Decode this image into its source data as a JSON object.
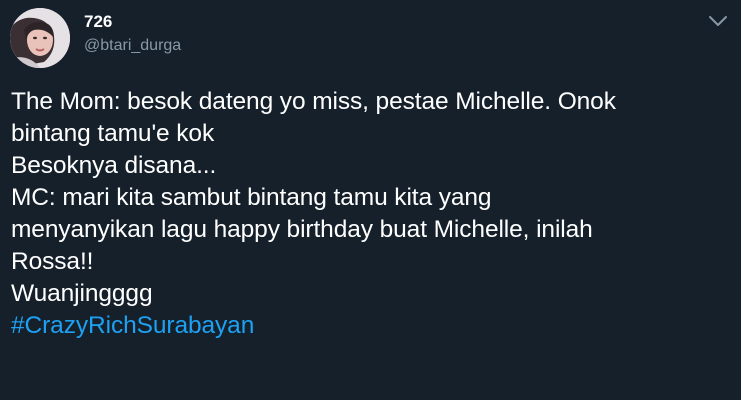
{
  "author": {
    "display_name": "726",
    "handle": "@btari_durga",
    "avatar_icon": "profile-photo"
  },
  "menu": {
    "icon": "chevron-down-icon"
  },
  "tweet": {
    "lines": [
      "The Mom: besok dateng yo miss, pestae Michelle. Onok",
      "bintang tamu'e kok",
      "Besoknya disana...",
      "MC: mari kita sambut bintang tamu kita yang",
      "menyanyikan lagu happy birthday buat Michelle, inilah",
      "Rossa!!",
      "Wuanjingggg"
    ],
    "hashtag": "#CrazyRichSurabayan"
  },
  "colors": {
    "background": "#15202b",
    "text": "#ffffff",
    "secondary_text": "#8899a6",
    "link": "#1da1f2"
  }
}
